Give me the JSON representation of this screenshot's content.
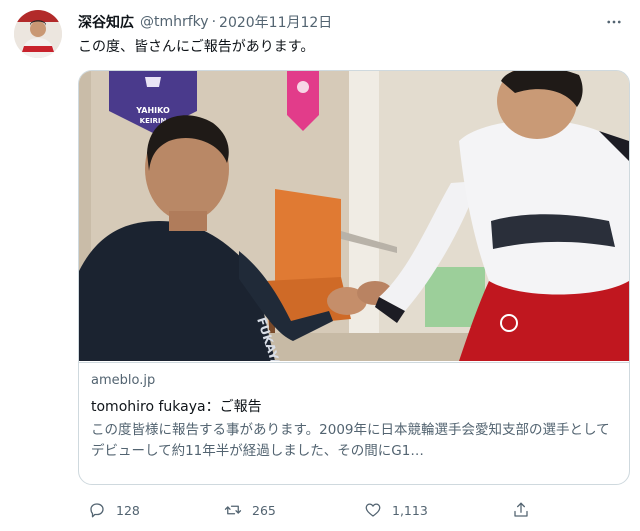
{
  "tweet": {
    "author": {
      "display_name": "深谷知広",
      "handle": "@tmhrfky",
      "separator": "·",
      "date": "2020年11月12日"
    },
    "text": "この度、皆さんにご報告があります。",
    "card": {
      "image": {
        "banner_left_text_1": "YAHIKO",
        "banner_left_text_2": "KEIRIN",
        "shirt_text": "FUKAYA"
      },
      "domain": "ameblo.jp",
      "title": "tomohiro fukaya：ご報告",
      "description": "この度皆様に報告する事があります。2009年に日本競輪選手会愛知支部の選手としてデビューして約11年半が経過しました、その間にG1…"
    },
    "actions": {
      "reply_count": "128",
      "retweet_count": "265",
      "like_count": "1,113"
    }
  },
  "icons": {
    "more": "more-dots-icon",
    "reply": "reply-icon",
    "retweet": "retweet-icon",
    "like": "heart-icon",
    "share": "share-icon"
  },
  "colors": {
    "text_primary": "#0f1419",
    "text_secondary": "#536471",
    "border": "#cfd9de",
    "banner_purple": "#4a3a8c",
    "banner_pink": "#e23c8a",
    "red_shorts": "#c0171f"
  }
}
